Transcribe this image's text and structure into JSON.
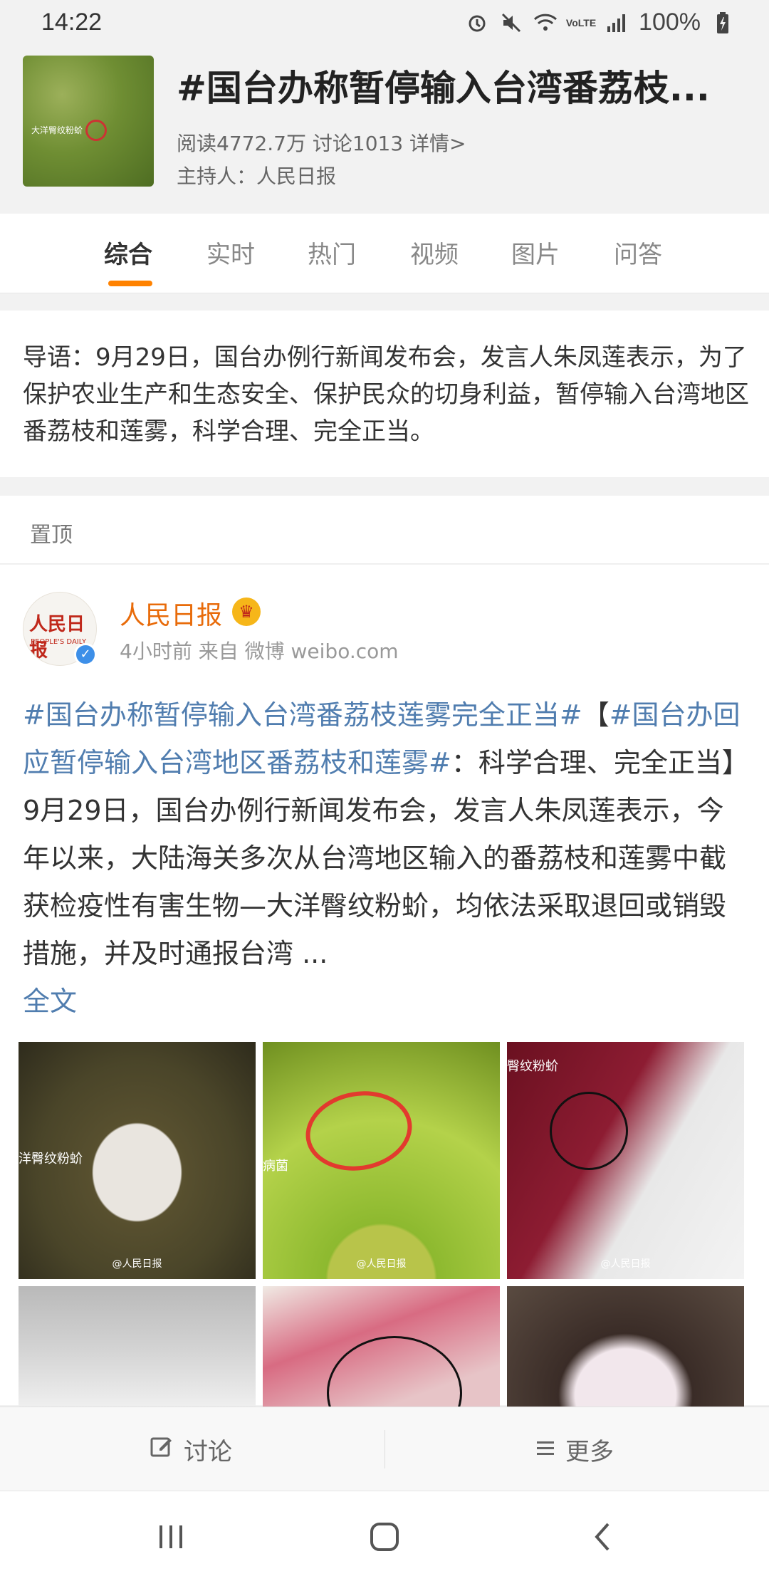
{
  "status_bar": {
    "time": "14:22",
    "battery": "100%",
    "icons": [
      "alarm-icon",
      "mute-icon",
      "wifi-icon",
      "volte-icon",
      "signal-icon",
      "battery-charging-icon"
    ]
  },
  "topic": {
    "title": "#国台办称暂停输入台湾番荔枝...",
    "stats": "阅读4772.7万 讨论1013 详情>",
    "host": "主持人：人民日报",
    "thumb_label": "大洋臀纹粉蚧"
  },
  "tabs": [
    "综合",
    "实时",
    "热门",
    "视频",
    "图片",
    "问答"
  ],
  "intro": "导语：9月29日，国台办例行新闻发布会，发言人朱凤莲表示，为了保护农业生产和生态安全、保护民众的切身利益，暂停输入台湾地区番荔枝和莲雾，科学合理、完全正当。",
  "pinned_label": "置顶",
  "post": {
    "author": "人民日报",
    "avatar_text": "人民日报",
    "avatar_sub": "PEOPLE'S DAILY",
    "meta": "4小时前 来自 微博 weibo.com",
    "topic1": "#国台办称暂停输入台湾番荔枝莲雾完全正当#",
    "bracket_open": "【",
    "topic2": "#国台办回应暂停输入台湾地区番荔枝和莲雾#",
    "body": "：科学合理、完全正当】9月29日，国台办例行新闻发布会，发言人朱凤莲表示，今年以来，大陆海关多次从台湾地区输入的番荔枝和莲雾中截获检疫性有害生物—大洋臀纹粉蚧，均依法采取退回或销毁措施，并及时通报台湾 ...",
    "full_text_link": "全文",
    "image_watermark": "@人民日报",
    "image_labels": [
      "洋臀纹粉蚧",
      "病菌",
      "臀纹粉蚧"
    ]
  },
  "bottom_actions": {
    "discuss": "讨论",
    "more": "更多"
  },
  "colors": {
    "accent": "#ff8200",
    "author": "#e86b0a",
    "link": "#507daf"
  }
}
